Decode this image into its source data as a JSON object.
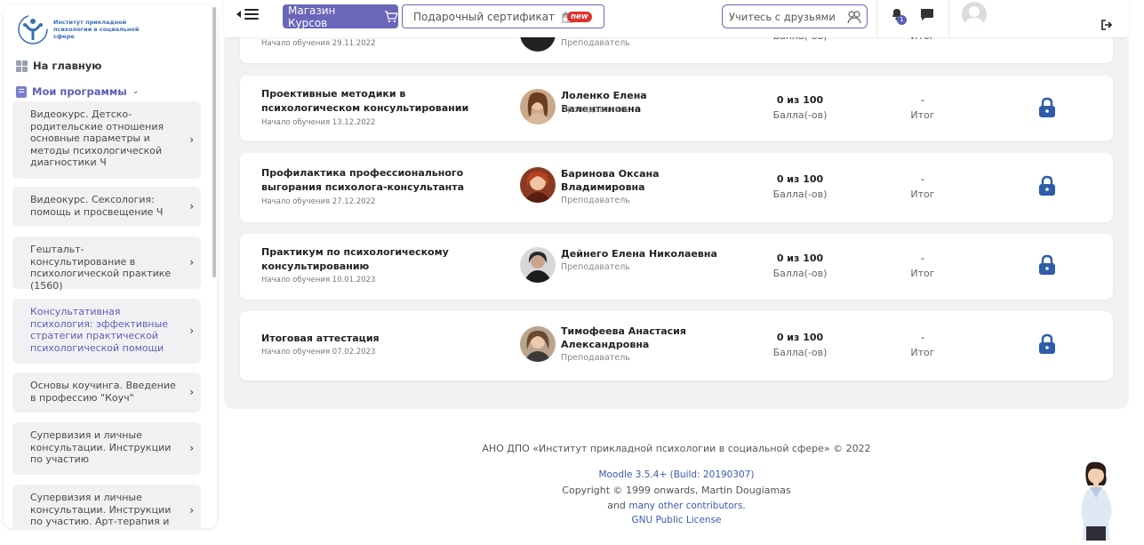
{
  "sidebar": {
    "logo_text": "Институт прикладной психологии в социальной сфере",
    "home_label": "На главную",
    "programs_label": "Мои программы",
    "programs": [
      {
        "label": "Видеокурс. Детско-родительские отношения основные параметры и методы психологической диагностики Ч",
        "active": false
      },
      {
        "label": "Видеокурс. Сексология: помощь и просвещение Ч",
        "active": false
      },
      {
        "label": "Гештальт-консультирование в психологической практике (1560)",
        "active": false
      },
      {
        "label": "Консультативная психология: эффективные стратегии практической психологической помощи",
        "active": true
      },
      {
        "label": "Основы коучинга. Введение в профессию \"Коуч\"",
        "active": false
      },
      {
        "label": "Супервизия и личные консультации. Инструкции по участию",
        "active": false
      },
      {
        "label": "Супервизия и личные консультации. Инструкции по участию. Арт-терапия и",
        "active": false
      }
    ]
  },
  "topbar": {
    "shop_label": "Магазин Курсов",
    "cert_label": "Подарочный сертификат",
    "new_badge": "new",
    "friends_label": "Учитесь с друзьями",
    "notification_count": "1"
  },
  "courses": [
    {
      "title": "",
      "start": "Начало обучения 29.11.2022",
      "teacher": "",
      "role": "Преподаватель",
      "score": "",
      "score_label": "Балла(-ов)",
      "result": "",
      "result_label": "Итог"
    },
    {
      "title": "Проективные методики в психологическом консультировании",
      "start": "Начало обучения 13.12.2022",
      "teacher": "Лоленко Елена Валентиновна",
      "role": "Преподаватель",
      "score": "0 из 100",
      "score_label": "Балла(-ов)",
      "result": "-",
      "result_label": "Итог"
    },
    {
      "title": "Профилактика профессионального выгорания психолога-консультанта",
      "start": "Начало обучения 27.12.2022",
      "teacher": "Баринова Оксана Владимировна",
      "role": "Преподаватель",
      "score": "0 из 100",
      "score_label": "Балла(-ов)",
      "result": "-",
      "result_label": "Итог"
    },
    {
      "title": "Практикум по психологическому консультированию",
      "start": "Начало обучения 10.01.2023",
      "teacher": "Дейнего Елена Николаевна",
      "role": "Преподаватель",
      "score": "0 из 100",
      "score_label": "Балла(-ов)",
      "result": "-",
      "result_label": "Итог"
    },
    {
      "title": "Итоговая аттестация",
      "start": "Начало обучения 07.02.2023",
      "teacher": "Тимофеева Анастасия Александровна",
      "role": "Преподаватель",
      "score": "0 из 100",
      "score_label": "Балла(-ов)",
      "result": "-",
      "result_label": "Итог"
    }
  ],
  "first_card_partial": {
    "score_label_partial": "Балла(-ов)",
    "result_label_partial": "Итог"
  },
  "footer": {
    "org": "АНО ДПО «Институт прикладной психологии в социальной сфере» © 2022",
    "moodle": "Moodle 3.5.4+ (Build: 20190307)",
    "copyright": "Copyright © 1999 onwards, Martin Dougiamas",
    "and": "and",
    "contributors": "many other contributors.",
    "license": "GNU Public License"
  },
  "colors": {
    "accent": "#6a66b8",
    "lock": "#2e5ca8",
    "badge": "#e0312f",
    "panel_bg": "#f2f2f4"
  }
}
